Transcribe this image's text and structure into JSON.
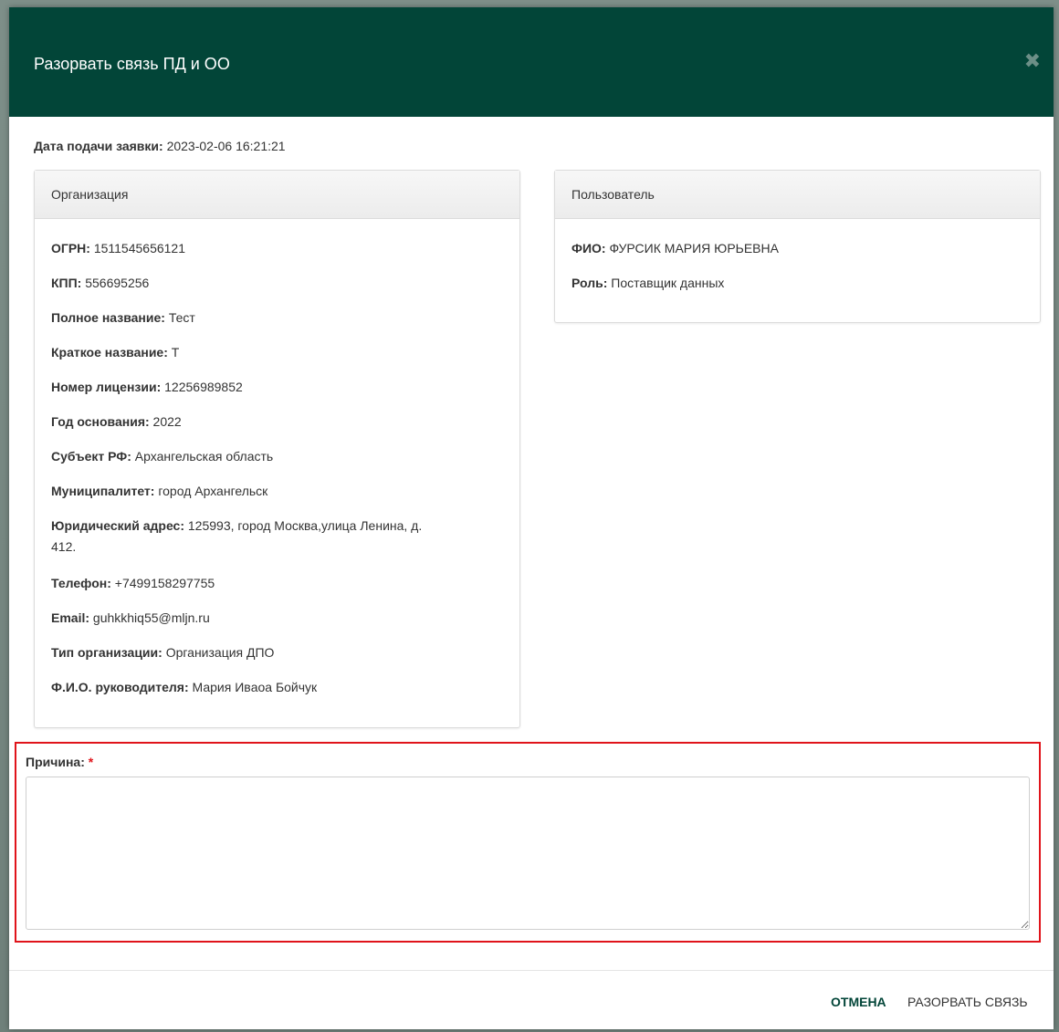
{
  "modal": {
    "title": "Разорвать связь ПД и ОО",
    "close_icon": "✖"
  },
  "application_date": {
    "label": "Дата подачи заявки:",
    "value": "2023-02-06 16:21:21"
  },
  "organization": {
    "heading": "Организация",
    "fields": [
      {
        "label": "ОГРН:",
        "value": "1511545656121"
      },
      {
        "label": "КПП:",
        "value": "556695256"
      },
      {
        "label": "Полное название:",
        "value": "Тест"
      },
      {
        "label": "Краткое название:",
        "value": "Т"
      },
      {
        "label": "Номер лицензии:",
        "value": "12256989852"
      },
      {
        "label": "Год основания:",
        "value": "2022"
      },
      {
        "label": "Субъект РФ:",
        "value": "Архангельская область"
      },
      {
        "label": "Муниципалитет:",
        "value": "город Архангельск"
      },
      {
        "label": "Юридический адрес:",
        "value": "125993, город Москва,улица Ленина, д.",
        "value_line2": "412."
      },
      {
        "label": "Телефон:",
        "value": "+7499158297755"
      },
      {
        "label": "Email:",
        "value": "guhkkhiq55@mljn.ru"
      },
      {
        "label": "Тип организации:",
        "value": "Организация ДПО"
      },
      {
        "label": "Ф.И.О. руководителя:",
        "value": "Мария Ивaоа Бойчук"
      }
    ]
  },
  "user": {
    "heading": "Пользователь",
    "fields": [
      {
        "label": "ФИО:",
        "value": "ФУРСИК МАРИЯ ЮРЬЕВНА"
      },
      {
        "label": "Роль:",
        "value": "Поставщик данных"
      }
    ]
  },
  "reason": {
    "label": "Причина:",
    "required_mark": "*",
    "value": "",
    "placeholder": ""
  },
  "footer": {
    "cancel_label": "ОТМЕНА",
    "submit_label": "РАЗОРВАТЬ СВЯЗЬ"
  },
  "colors": {
    "header": "#024538",
    "highlight_border": "#e0141b"
  }
}
